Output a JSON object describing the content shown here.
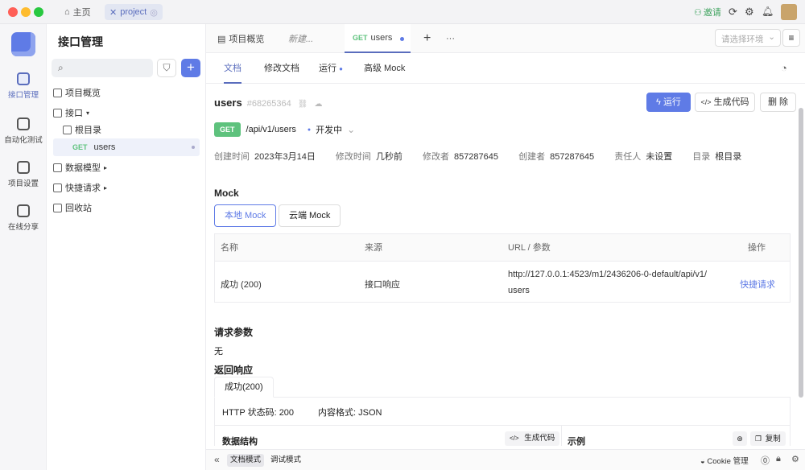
{
  "titlebar": {
    "home_tab": "主页",
    "project_tab": "project",
    "invite": "邀请"
  },
  "nav": {
    "items": [
      {
        "label": "接口管理",
        "icon": "api-management-icon"
      },
      {
        "label": "自动化测试",
        "icon": "automation-test-icon"
      },
      {
        "label": "项目设置",
        "icon": "project-settings-icon"
      },
      {
        "label": "在线分享",
        "icon": "online-share-icon"
      }
    ]
  },
  "sidebar": {
    "title": "接口管理",
    "tree": {
      "overview": "项目概览",
      "api": "接口",
      "root": "根目录",
      "endpoint_method": "GET",
      "endpoint_name": "users",
      "data_models": "数据模型",
      "quick_requests": "快捷请求",
      "recycle": "回收站"
    }
  },
  "tabs": {
    "overview": "项目概览",
    "new": "新建...",
    "active_method": "GET",
    "active_name": "users",
    "env_placeholder": "请选择环境"
  },
  "subtabs": {
    "doc": "文档",
    "edit": "修改文档",
    "run": "运行",
    "mock": "高级 Mock"
  },
  "api": {
    "name": "users",
    "id": "#68265364",
    "method": "GET",
    "path": "/api/v1/users",
    "status": "开发中",
    "run_label": "运行",
    "gen_code_label": "生成代码",
    "delete_label": "删 除"
  },
  "meta": {
    "created_label": "创建时间",
    "created": "2023年3月14日",
    "modified_label": "修改时间",
    "modified": "几秒前",
    "modifier_label": "修改者",
    "modifier": "857287645",
    "creator_label": "创建者",
    "creator": "857287645",
    "owner_label": "责任人",
    "owner": "未设置",
    "dir_label": "目录",
    "dir": "根目录"
  },
  "mock": {
    "title": "Mock",
    "local_tab": "本地 Mock",
    "cloud_tab": "云端 Mock",
    "headers": [
      "名称",
      "来源",
      "URL / 参数",
      "操作"
    ],
    "row": {
      "name": "成功 (200)",
      "source": "接口响应",
      "url_line1": "http://127.0.0.1:4523/m1/2436206-0-default/api/v1/",
      "url_line2": "users",
      "action": "快捷请求"
    }
  },
  "request": {
    "title": "请求参数",
    "empty": "无"
  },
  "response": {
    "title": "返回响应",
    "tab": "成功(200)",
    "status_code": "HTTP 状态码: 200",
    "content_type": "内容格式: JSON",
    "schema_label": "数据结构",
    "gen_code_label": "生成代码",
    "example_label": "示例",
    "copy_label": "复制"
  },
  "bottombar": {
    "doc_mode": "文档模式",
    "debug_mode": "调试模式",
    "cookie": "Cookie 管理"
  },
  "colors": {
    "accent": "#5f7be6",
    "get": "#5ec27d",
    "invite": "#3fa35f"
  }
}
